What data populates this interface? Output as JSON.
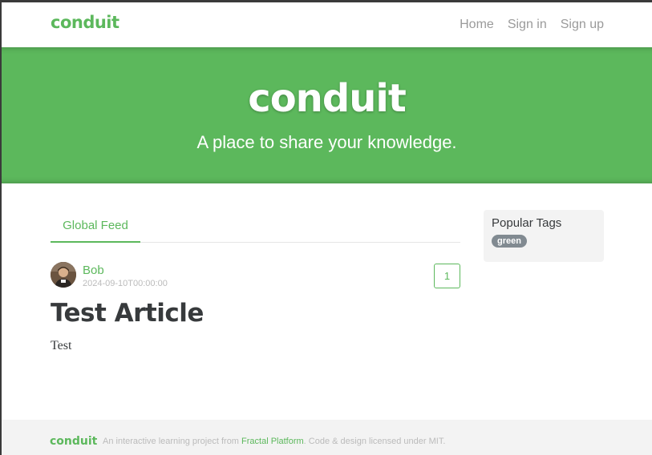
{
  "navbar": {
    "brand": "conduit",
    "links": [
      "Home",
      "Sign in",
      "Sign up"
    ]
  },
  "banner": {
    "title": "conduit",
    "subtitle": "A place to share your knowledge."
  },
  "feed": {
    "tabs": [
      "Global Feed"
    ]
  },
  "articles": [
    {
      "author": "Bob",
      "date": "2024-09-10T00:00:00",
      "favorites": "1",
      "title": "Test Article",
      "description": "Test"
    }
  ],
  "sidebar": {
    "title": "Popular Tags",
    "tags": [
      "green"
    ]
  },
  "footer": {
    "brand": "conduit",
    "text_before": "An interactive learning project from ",
    "link": "Fractal Platform",
    "text_after": ". Code & design licensed under MIT."
  },
  "colors": {
    "brand": "#5cb85c",
    "tag": "#818a91",
    "text": "#373a3c",
    "muted": "#bbbbbb"
  }
}
